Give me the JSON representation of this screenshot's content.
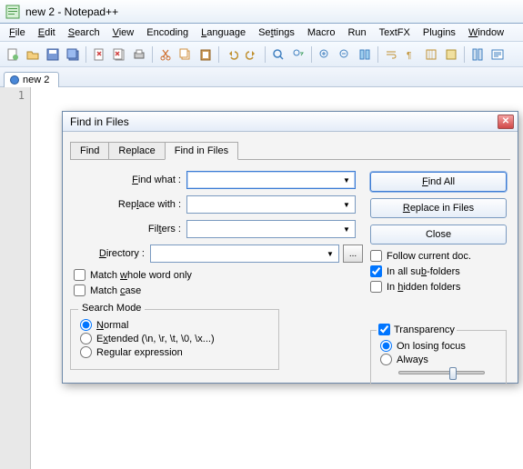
{
  "window": {
    "title": "new  2 - Notepad++"
  },
  "menu": {
    "items": [
      "File",
      "Edit",
      "Search",
      "View",
      "Encoding",
      "Language",
      "Settings",
      "Macro",
      "Run",
      "TextFX",
      "Plugins",
      "Window"
    ]
  },
  "filetab": {
    "name": "new  2"
  },
  "editor": {
    "line1": "1"
  },
  "dialog": {
    "title": "Find in Files",
    "tabs": {
      "find": "Find",
      "replace": "Replace",
      "findinfiles": "Find in Files"
    },
    "labels": {
      "findwhat": "Find what :",
      "replacewith": "Replace with :",
      "filters": "Filters :",
      "directory": "Directory :"
    },
    "dirbrowse": "...",
    "buttons": {
      "findall": "Find All",
      "replaceinfiles": "Replace in Files",
      "close": "Close"
    },
    "checks": {
      "followcurrent": "Follow current doc.",
      "subfolders": "In all sub-folders",
      "hidden": "In hidden folders",
      "wholeword": "Match whole word only",
      "matchcase": "Match case"
    },
    "checksState": {
      "followcurrent": false,
      "subfolders": true,
      "hidden": false,
      "wholeword": false,
      "matchcase": false
    },
    "searchmode": {
      "legend": "Search Mode",
      "normal": "Normal",
      "extended": "Extended (\\n, \\r, \\t, \\0, \\x...)",
      "regex": "Regular expression",
      "selected": "normal"
    },
    "transparency": {
      "legend": "Transparency",
      "enabled": true,
      "onlosing": "On losing focus",
      "always": "Always",
      "selected": "onlosing"
    }
  }
}
